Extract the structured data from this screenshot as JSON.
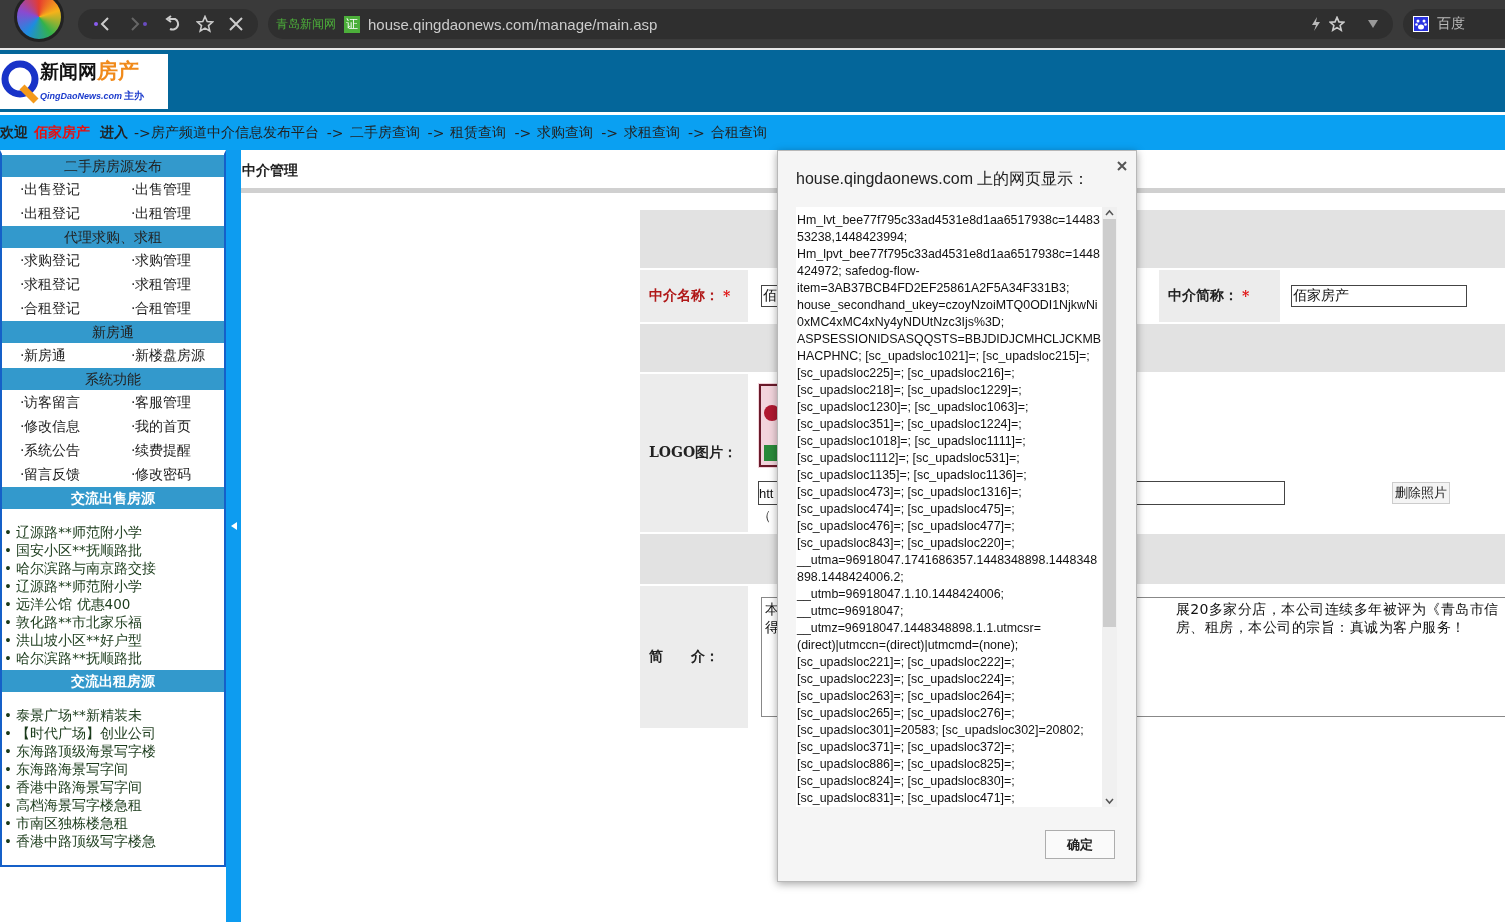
{
  "browser": {
    "site_badge": "青岛新闻网",
    "cert_badge": "证",
    "url": "house.qingdaonews.com/manage/main.asp",
    "search_engine": "百度"
  },
  "logo": {
    "title": "新闻网",
    "title_accent": "房产",
    "subtitle": "QingDaoNews.com",
    "subtitle_suffix": "主办"
  },
  "nav": {
    "welcome": "欢迎",
    "user": "佰家房产",
    "enter": "进入",
    "links": [
      {
        "arrow": "->",
        "label": "房产频道中介信息发布平台"
      },
      {
        "arrow": "->",
        "label": "二手房查询"
      },
      {
        "arrow": "->",
        "label": "租赁查询"
      },
      {
        "arrow": "->",
        "label": "求购查询"
      },
      {
        "arrow": "->",
        "label": "求租查询"
      },
      {
        "arrow": "->",
        "label": "合租查询"
      }
    ]
  },
  "sidebar": {
    "sections": [
      {
        "kind": "menu",
        "title": "二手房房源发布",
        "items": [
          "·出售登记",
          "·出售管理",
          "·出租登记",
          "·出租管理"
        ]
      },
      {
        "kind": "menu",
        "title": "代理求购、求租",
        "items": [
          "·求购登记",
          "·求购管理",
          "·求租登记",
          "·求租管理",
          "·合租登记",
          "·合租管理"
        ]
      },
      {
        "kind": "menu",
        "title": "新房通",
        "items": [
          "·新房通",
          "·新楼盘房源"
        ]
      },
      {
        "kind": "menu",
        "title": "系统功能",
        "items": [
          "·访客留言",
          "·客服管理",
          "·修改信息",
          "·我的首页",
          "·系统公告",
          "·续费提醒",
          "·留言反馈",
          "·修改密码"
        ]
      },
      {
        "kind": "list",
        "title": "交流出售房源",
        "items": [
          "• 辽源路**师范附小学",
          "• 国安小区**抚顺路批",
          "• 哈尔滨路与南京路交接",
          "• 辽源路**师范附小学",
          "• 远洋公馆  优惠400",
          "• 敦化路**市北家乐福",
          "• 洪山坡小区**好户型",
          "• 哈尔滨路**抚顺路批"
        ]
      },
      {
        "kind": "list",
        "title": "交流出租房源",
        "items": [
          "• 泰景广场**新精装未",
          "• 【时代广场】创业公司",
          "• 东海路顶级海景写字楼",
          "• 东海路海景写字间",
          "• 香港中路海景写字间",
          "• 高档海景写字楼急租",
          "• 市南区独栋楼急租",
          "• 香港中路顶级写字楼急"
        ]
      }
    ]
  },
  "page_title": "中介管理",
  "form": {
    "name_label": "中介名称：",
    "name_required": "*",
    "name_value": "佰",
    "short_label": "中介简称：",
    "short_required": "*",
    "short_value": "佰家房产",
    "logo_label": "LOGO图片：",
    "logo_url": "htt",
    "logo_hint": "（",
    "delete_button": "删除照片",
    "intro_label": "简　　介：",
    "intro_left": [
      "本",
      "得"
    ],
    "intro_right": [
      "展20多家分店，本公司连续多年被评为《青岛市信",
      "房、租房，本公司的宗旨：真诚为客户服务！"
    ]
  },
  "dialog": {
    "title": "house.qingdaonews.com 上的网页显示：",
    "message": "Hm_lvt_bee77f795c33ad4531e8d1aa6517938c=1448353238,1448423994; Hm_lpvt_bee77f795c33ad4531e8d1aa6517938c=1448424972; safedog-flow-item=3AB37BCB4FD2EF25861A2F5A34F331B3; house_secondhand_ukey=czoyNzoiMTQ0ODI1NjkwNi0xMC4xMC4xNy4yNDUtNzc3Ijs%3D; ASPSESSIONIDSASQQSTS=BBJDIDJCMHCLJCKMBHACPHNC; [sc_upadsloc1021]=; [sc_upadsloc215]=; [sc_upadsloc225]=; [sc_upadsloc216]=; [sc_upadsloc218]=; [sc_upadsloc1229]=; [sc_upadsloc1230]=; [sc_upadsloc1063]=; [sc_upadsloc351]=; [sc_upadsloc1224]=; [sc_upadsloc1018]=; [sc_upadsloc1111]=; [sc_upadsloc1112]=; [sc_upadsloc531]=; [sc_upadsloc1135]=; [sc_upadsloc1136]=; [sc_upadsloc473]=; [sc_upadsloc1316]=; [sc_upadsloc474]=; [sc_upadsloc475]=; [sc_upadsloc476]=; [sc_upadsloc477]=; [sc_upadsloc843]=; [sc_upadsloc220]=; __utma=96918047.1741686357.1448348898.1448348898.1448424006.2; __utmb=96918047.1.10.1448424006; __utmc=96918047; __utmz=96918047.1448348898.1.1.utmcsr=(direct)|utmccn=(direct)|utmcmd=(none); [sc_upadsloc221]=; [sc_upadsloc222]=; [sc_upadsloc223]=; [sc_upadsloc224]=; [sc_upadsloc263]=; [sc_upadsloc264]=; [sc_upadsloc265]=; [sc_upadsloc276]=; [sc_upadsloc301]=20583; [sc_upadsloc302]=20802; [sc_upadsloc371]=; [sc_upadsloc372]=; [sc_upadsloc886]=; [sc_upadsloc825]=; [sc_upadsloc824]=; [sc_upadsloc830]=; [sc_upadsloc831]=; [sc_upadsloc471]=;",
    "ok_button": "确定"
  }
}
